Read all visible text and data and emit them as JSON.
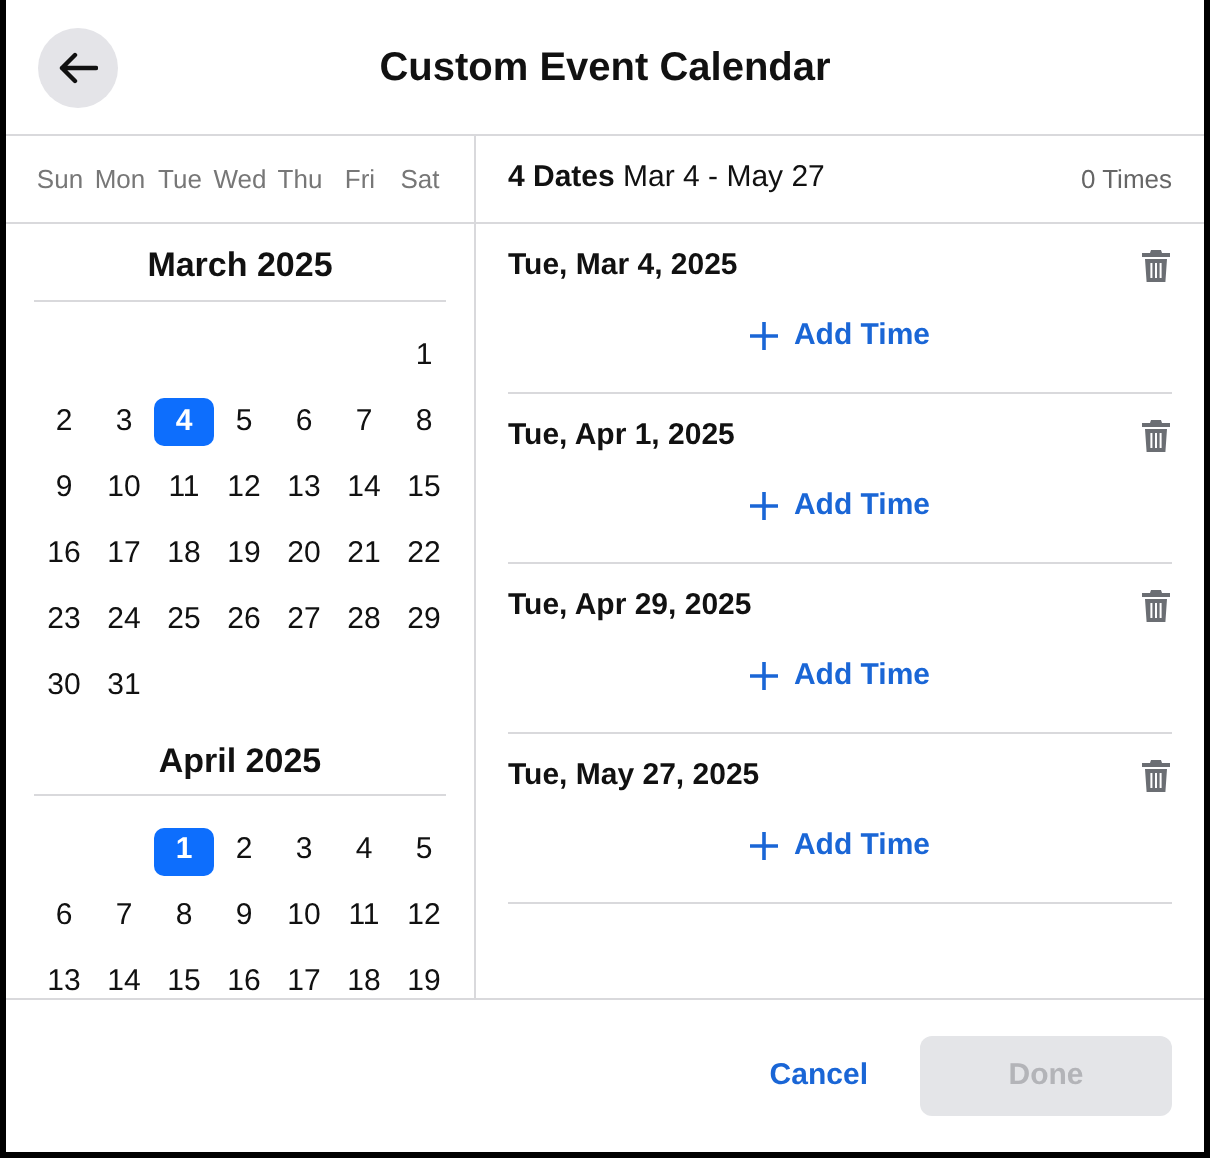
{
  "title": "Custom Event Calendar",
  "weekdays": [
    "Sun",
    "Mon",
    "Tue",
    "Wed",
    "Thu",
    "Fri",
    "Sat"
  ],
  "months": [
    {
      "title": "March 2025",
      "weeks": [
        {
          "kind": "first",
          "days": [
            {
              "day": "1",
              "selected": false
            }
          ]
        },
        {
          "kind": "full",
          "days": [
            {
              "day": "2",
              "selected": false
            },
            {
              "day": "3",
              "selected": false
            },
            {
              "day": "4",
              "selected": true
            },
            {
              "day": "5",
              "selected": false
            },
            {
              "day": "6",
              "selected": false
            },
            {
              "day": "7",
              "selected": false
            },
            {
              "day": "8",
              "selected": false
            }
          ]
        },
        {
          "kind": "full",
          "days": [
            {
              "day": "9",
              "selected": false
            },
            {
              "day": "10",
              "selected": false
            },
            {
              "day": "11",
              "selected": false
            },
            {
              "day": "12",
              "selected": false
            },
            {
              "day": "13",
              "selected": false
            },
            {
              "day": "14",
              "selected": false
            },
            {
              "day": "15",
              "selected": false
            }
          ]
        },
        {
          "kind": "full",
          "days": [
            {
              "day": "16",
              "selected": false
            },
            {
              "day": "17",
              "selected": false
            },
            {
              "day": "18",
              "selected": false
            },
            {
              "day": "19",
              "selected": false
            },
            {
              "day": "20",
              "selected": false
            },
            {
              "day": "21",
              "selected": false
            },
            {
              "day": "22",
              "selected": false
            }
          ]
        },
        {
          "kind": "full",
          "days": [
            {
              "day": "23",
              "selected": false
            },
            {
              "day": "24",
              "selected": false
            },
            {
              "day": "25",
              "selected": false
            },
            {
              "day": "26",
              "selected": false
            },
            {
              "day": "27",
              "selected": false
            },
            {
              "day": "28",
              "selected": false
            },
            {
              "day": "29",
              "selected": false
            }
          ]
        },
        {
          "kind": "last",
          "days": [
            {
              "day": "30",
              "selected": false
            },
            {
              "day": "31",
              "selected": false
            }
          ]
        }
      ]
    },
    {
      "title": "April 2025",
      "weeks": [
        {
          "kind": "first",
          "days": [
            {
              "day": "1",
              "selected": true
            },
            {
              "day": "2",
              "selected": false
            },
            {
              "day": "3",
              "selected": false
            },
            {
              "day": "4",
              "selected": false
            },
            {
              "day": "5",
              "selected": false
            }
          ]
        },
        {
          "kind": "full",
          "days": [
            {
              "day": "6",
              "selected": false
            },
            {
              "day": "7",
              "selected": false
            },
            {
              "day": "8",
              "selected": false
            },
            {
              "day": "9",
              "selected": false
            },
            {
              "day": "10",
              "selected": false
            },
            {
              "day": "11",
              "selected": false
            },
            {
              "day": "12",
              "selected": false
            }
          ]
        },
        {
          "kind": "full",
          "days": [
            {
              "day": "13",
              "selected": false
            },
            {
              "day": "14",
              "selected": false
            },
            {
              "day": "15",
              "selected": false
            },
            {
              "day": "16",
              "selected": false
            },
            {
              "day": "17",
              "selected": false
            },
            {
              "day": "18",
              "selected": false
            },
            {
              "day": "19",
              "selected": false
            }
          ]
        }
      ]
    }
  ],
  "summary": {
    "dates": "**4 Dates** Mar 4 - May 27",
    "times": "0 Times"
  },
  "dates": [
    {
      "label": "Tue, Mar 4, 2025",
      "action": "Add Time"
    },
    {
      "label": "Tue, Apr 1, 2025",
      "action": "Add Time"
    },
    {
      "label": "Tue, Apr 29, 2025",
      "action": "Add Time"
    },
    {
      "label": "Tue, May 27, 2025",
      "action": "Add Time"
    }
  ],
  "buttons": {
    "cancel": "Cancel",
    "done": {
      "label": "Done",
      "disabled": true
    }
  }
}
